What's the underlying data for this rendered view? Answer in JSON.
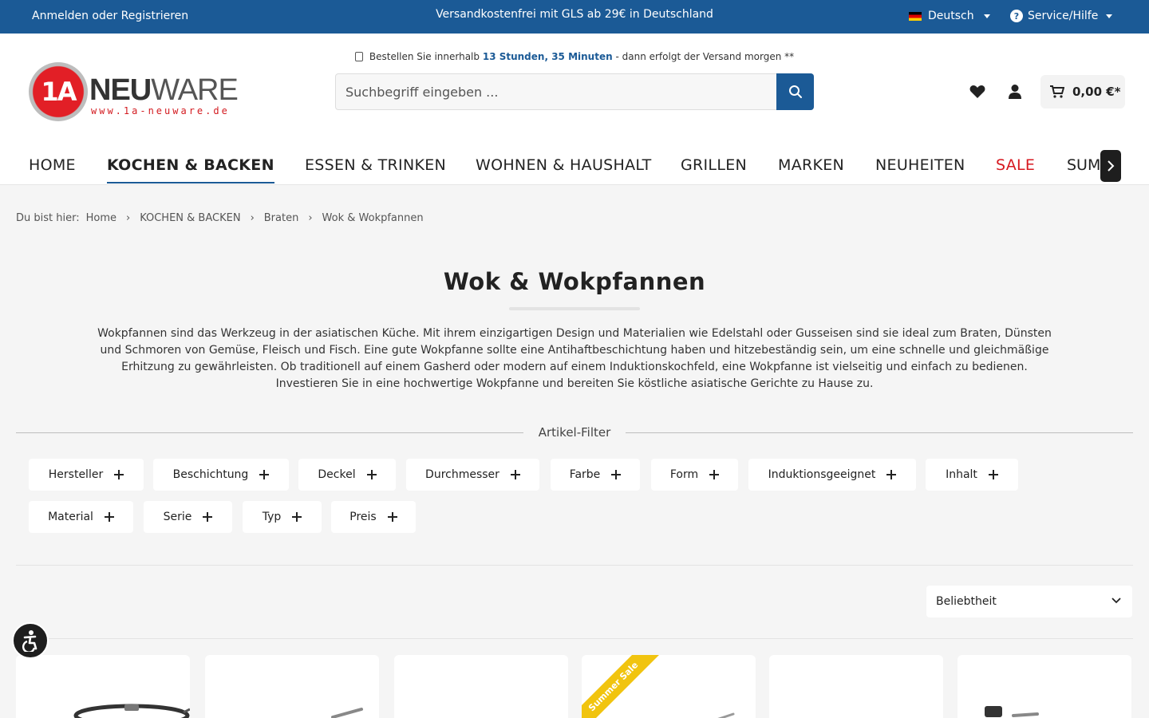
{
  "topbar": {
    "login": "Anmelden oder Registrieren",
    "promo": "Versandkostenfrei mit GLS ab 29€ in Deutschland",
    "language": "Deutsch",
    "service": "Service/Hilfe"
  },
  "header": {
    "logo_brand_bold": "NEU",
    "logo_brand_light": "WARE",
    "logo_prefix": "1A",
    "logo_url": "www.1a-neuware.de",
    "timer_prefix": "Bestellen Sie innerhalb",
    "timer_value": "13 Stunden, 35 Minuten",
    "timer_suffix": "- dann erfolgt der Versand morgen **",
    "search_placeholder": "Suchbegriff eingeben ...",
    "cart_total": "0,00 €*"
  },
  "nav": {
    "items": [
      {
        "label": "HOME"
      },
      {
        "label": "KOCHEN & BACKEN"
      },
      {
        "label": "ESSEN & TRINKEN"
      },
      {
        "label": "WOHNEN & HAUSHALT"
      },
      {
        "label": "GRILLEN"
      },
      {
        "label": "MARKEN"
      },
      {
        "label": "NEUHEITEN"
      },
      {
        "label": "SALE"
      },
      {
        "label": "SUM"
      }
    ]
  },
  "breadcrumb": {
    "label": "Du bist hier:",
    "items": [
      "Home",
      "KOCHEN & BACKEN",
      "Braten",
      "Wok & Wokpfannen"
    ]
  },
  "category": {
    "title": "Wok & Wokpfannen",
    "description": "Wokpfannen sind das Werkzeug in der asiatischen Küche. Mit ihrem einzigartigen Design und Materialien wie Edelstahl oder Gusseisen sind sie ideal zum Braten, Dünsten und Schmoren von Gemüse, Fleisch und Fisch. Eine gute Wokpfanne sollte eine Antihaftbeschichtung haben und hitzebeständig sein, um eine schnelle und gleichmäßige Erhitzung zu gewährleisten. Ob traditionell auf einem Gasherd oder modern auf einem Induktionskochfeld, eine Wokpfanne ist vielseitig und einfach zu bedienen. Investieren Sie in eine hochwertige Wokpfanne und bereiten Sie köstliche asiatische Gerichte zu Hause zu."
  },
  "filters": {
    "heading": "Artikel-Filter",
    "items": [
      "Hersteller",
      "Beschichtung",
      "Deckel",
      "Durchmesser",
      "Farbe",
      "Form",
      "Induktionsgeeignet",
      "Inhalt",
      "Material",
      "Serie",
      "Typ",
      "Preis"
    ]
  },
  "sorting": {
    "selected": "Beliebtheit"
  },
  "products": {
    "badge": "Summer Sale"
  },
  "colors": {
    "brand_blue": "#1b5a96",
    "sale_red": "#d71920",
    "badge_yellow": "#f1c40f"
  }
}
